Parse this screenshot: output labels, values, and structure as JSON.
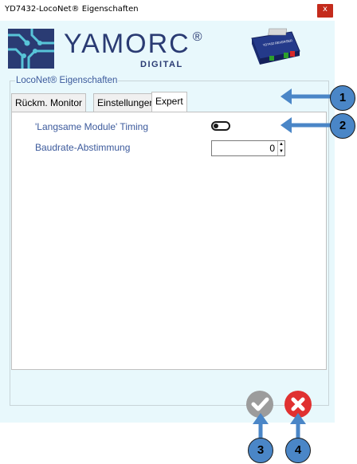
{
  "window": {
    "title": "YD7432-LocoNet® Eigenschaften",
    "close_glyph": "x"
  },
  "logo": {
    "brand": "YAMORC",
    "registered": "®",
    "sub": "DIGITAL",
    "device_label": "YD7432 REVERSER"
  },
  "group": {
    "legend": "LocoNet® Eigenschaften"
  },
  "tabs": [
    {
      "label": "Rückm. Monitor",
      "active": false
    },
    {
      "label": "Einstellungen",
      "active": false
    },
    {
      "label": "Expert",
      "active": true
    }
  ],
  "settings": {
    "slow_modules_label": "'Langsame Module' Timing",
    "slow_modules_enabled": false,
    "baudrate_label": "Baudrate-Abstimmung",
    "baudrate_value": "0"
  },
  "actions": {
    "ok_icon": "checkmark-icon",
    "cancel_icon": "close-icon"
  },
  "callouts": [
    "1",
    "2",
    "3",
    "4"
  ],
  "colors": {
    "window_bg": "#e8f8fc",
    "label_blue": "#3c5a9c",
    "brand_navy": "#2a3b73",
    "callout_blue": "#4a86c7",
    "cancel_red": "#e03131",
    "ok_grey": "#9c9c9c"
  }
}
